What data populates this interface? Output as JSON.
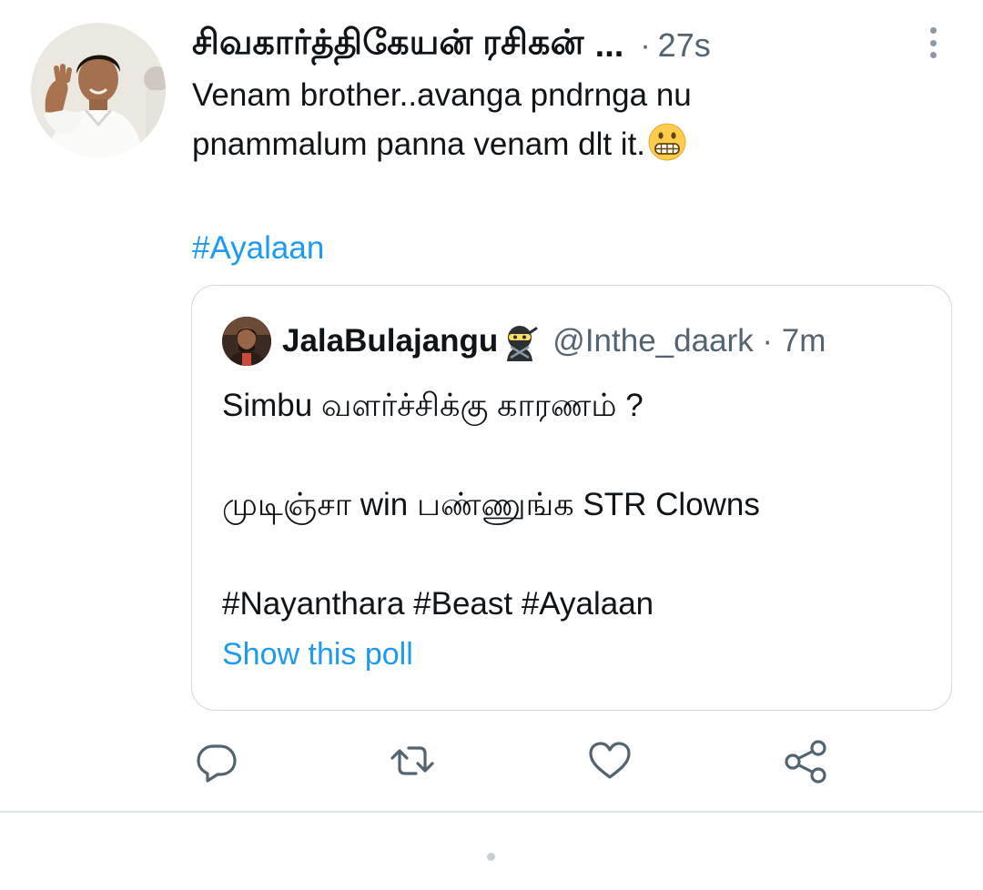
{
  "tweet": {
    "display_name": "சிவகார்த்திகேயன் ரசிகன்",
    "ellipsis": "...",
    "separator": "·",
    "time": "27s",
    "body_line1": "Venam brother..avanga pndrnga nu",
    "body_line2": "pnammalum panna venam dlt it.",
    "emoji": "grimacing-face",
    "hashtag": "#Ayalaan"
  },
  "quote": {
    "display_name": "JalaBulajangu",
    "badge_emoji": "ninja",
    "handle_time": "@Inthe_daark · 7m",
    "line1": "Simbu வளர்ச்சிக்கு காரணம் ?",
    "line2": "முடிஞ்சா win பண்ணுங்க STR Clowns",
    "hashtags": "#Nayanthara #Beast #Ayalaan",
    "poll_link": "Show this poll"
  },
  "actions": {
    "reply_icon": "reply-icon",
    "retweet_icon": "retweet-icon",
    "like_icon": "heart-icon",
    "share_icon": "share-icon"
  },
  "colors": {
    "accent": "#1d9bf0",
    "text": "#0f1419",
    "muted": "#536471",
    "border": "#cfd9de"
  }
}
